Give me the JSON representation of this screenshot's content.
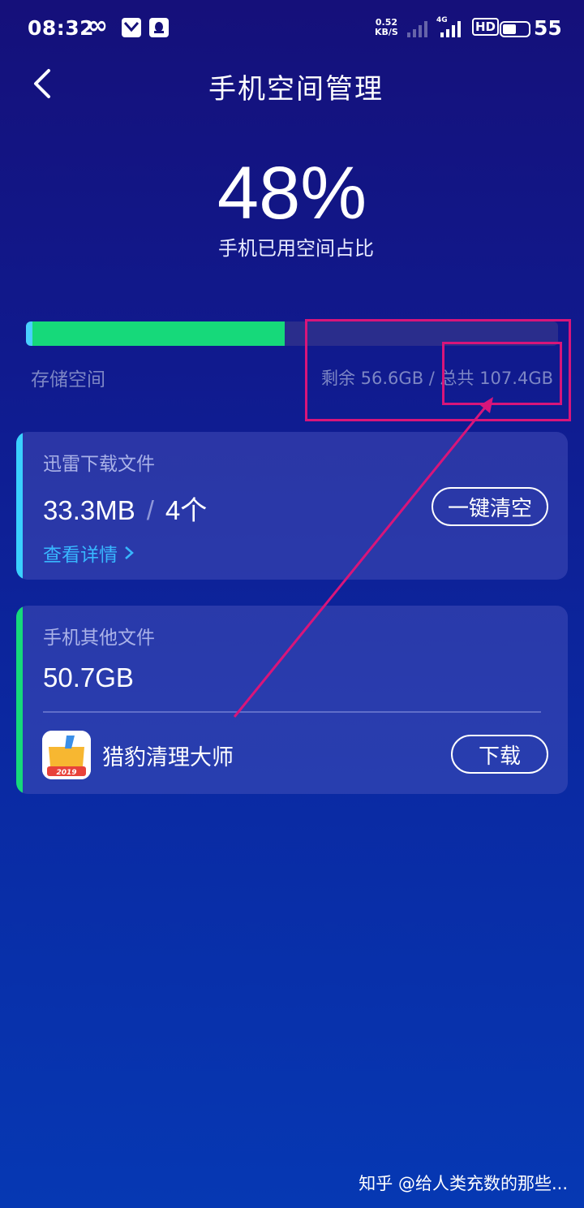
{
  "status_bar": {
    "time": "08:32",
    "network_speed_value": "0.52",
    "network_speed_unit": "KB/S",
    "network_type": "4G",
    "hd_label": "HD",
    "battery_level": "55",
    "icons": [
      "infinity-icon",
      "app-notification-icon",
      "qq-icon",
      "signal-icon",
      "headset-icon",
      "battery-icon"
    ]
  },
  "header": {
    "title": "手机空间管理"
  },
  "usage": {
    "percent": "48%",
    "caption": "手机已用空间占比",
    "used_fraction": 0.48
  },
  "storage": {
    "label": "存储空间",
    "summary": "剩余 56.6GB / 总共 107.4GB"
  },
  "cards": {
    "xunlei": {
      "title": "迅雷下载文件",
      "size": "33.3MB",
      "separator": "/",
      "count": "4个",
      "clear_button": "一键清空",
      "details_link": "查看详情",
      "accent_color": "#3ad0ff"
    },
    "other": {
      "title": "手机其他文件",
      "size": "50.7GB",
      "app_name": "猎豹清理大师",
      "app_icon_year": "2019",
      "download_button": "下载",
      "accent_color": "#16d97a"
    }
  },
  "colors": {
    "annotation": "#d8157a",
    "usage_bar_fill": "#16d97a",
    "link": "#38b7ff"
  },
  "watermark": "知乎 @给人类充数的那些..."
}
